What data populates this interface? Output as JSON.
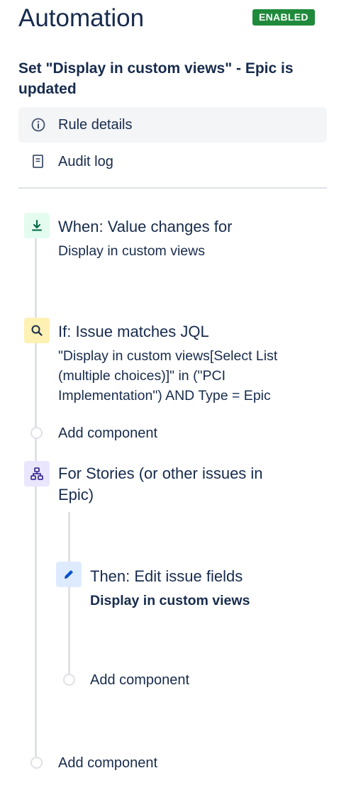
{
  "header": {
    "title": "Automation",
    "status": "ENABLED",
    "rule_name": "Set \"Display in custom views\" - Epic is updated"
  },
  "nav": {
    "items": [
      {
        "label": "Rule details",
        "icon": "info-icon",
        "active": true
      },
      {
        "label": "Audit log",
        "icon": "document-icon",
        "active": false
      }
    ]
  },
  "rule": {
    "trigger": {
      "icon": "download-arrow-icon",
      "title": "When: Value changes for",
      "description": "Display in custom views"
    },
    "condition": {
      "icon": "search-icon",
      "title": "If: Issue matches JQL",
      "description": "\"Display in custom views[Select List (multiple choices)]\" in (\"PCI Implementation\") AND Type = Epic"
    },
    "add_component_1": "Add component",
    "branch": {
      "icon": "hierarchy-icon",
      "title": "For Stories (or other issues in Epic)"
    },
    "action": {
      "icon": "pencil-icon",
      "title": "Then: Edit issue fields",
      "description": "Display in custom views"
    },
    "add_component_inner": "Add component",
    "add_component_outer": "Add component"
  },
  "colors": {
    "enabled_badge": "#1F8A3B",
    "text": "#172B4D",
    "trigger_bg": "#E3FCEF",
    "condition_bg": "#FFF0B3",
    "branch_bg": "#EAE6FF",
    "action_bg": "#DEEBFF",
    "line": "#DFE1E6"
  }
}
